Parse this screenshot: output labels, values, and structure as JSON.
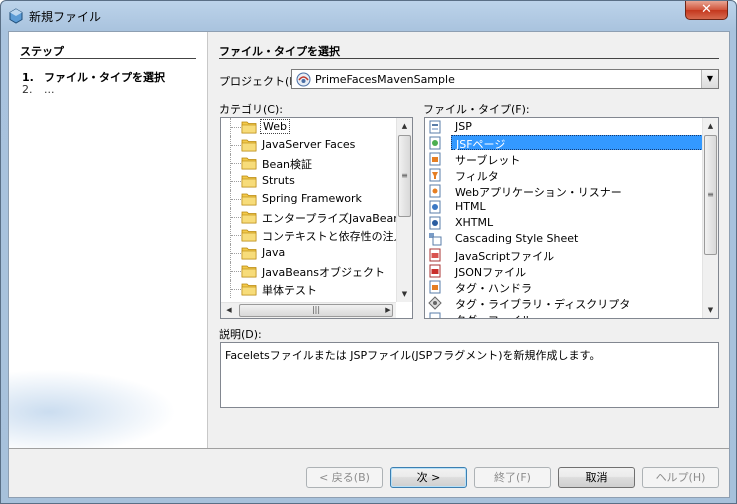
{
  "window": {
    "title": "新規ファイル",
    "close_label": "✕"
  },
  "steps": {
    "title": "ステップ",
    "items": [
      {
        "num": "1.",
        "label": "ファイル・タイプを選択"
      },
      {
        "num": "2.",
        "label": "..."
      }
    ]
  },
  "panel": {
    "title": "ファイル・タイプを選択",
    "project_label": "プロジェクト(P):",
    "project_value": "PrimeFacesMavenSample",
    "categories_label": "カテゴリ(C):",
    "file_types_label": "ファイル・タイプ(F):",
    "categories": [
      "Web",
      "JavaServer Faces",
      "Bean検証",
      "Struts",
      "Spring Framework",
      "エンタープライズJavaBeans",
      "コンテキストと依存性の注入",
      "Java",
      "JavaBeansオブジェクト",
      "単体テスト"
    ],
    "selected_category": "Web",
    "file_types": [
      {
        "label": "JSP",
        "icon": "jsp-file-icon"
      },
      {
        "label": "JSFページ",
        "icon": "jsf-page-icon"
      },
      {
        "label": "サーブレット",
        "icon": "servlet-icon"
      },
      {
        "label": "フィルタ",
        "icon": "filter-icon"
      },
      {
        "label": "Webアプリケーション・リスナー",
        "icon": "listener-icon"
      },
      {
        "label": "HTML",
        "icon": "html-file-icon"
      },
      {
        "label": "XHTML",
        "icon": "xhtml-file-icon"
      },
      {
        "label": "Cascading Style Sheet",
        "icon": "css-file-icon"
      },
      {
        "label": "JavaScriptファイル",
        "icon": "javascript-file-icon"
      },
      {
        "label": "JSONファイル",
        "icon": "json-file-icon"
      },
      {
        "label": "タグ・ハンドラ",
        "icon": "tag-handler-icon"
      },
      {
        "label": "タグ・ライブラリ・ディスクリプタ",
        "icon": "tld-icon"
      },
      {
        "label": "タグ・ファイル",
        "icon": "tag-file-icon"
      }
    ],
    "selected_file_type": "JSFページ",
    "description_label": "説明(D):",
    "description": "Faceletsファイルまたは JSPファイル(JSPフラグメント)を新規作成します。"
  },
  "buttons": {
    "back": "< 戻る(B)",
    "next": "次 >",
    "finish": "終了(F)",
    "cancel": "取消",
    "help": "ヘルプ(H)"
  },
  "colors": {
    "selection": "#3399ff",
    "folder": "#f2c94c"
  }
}
